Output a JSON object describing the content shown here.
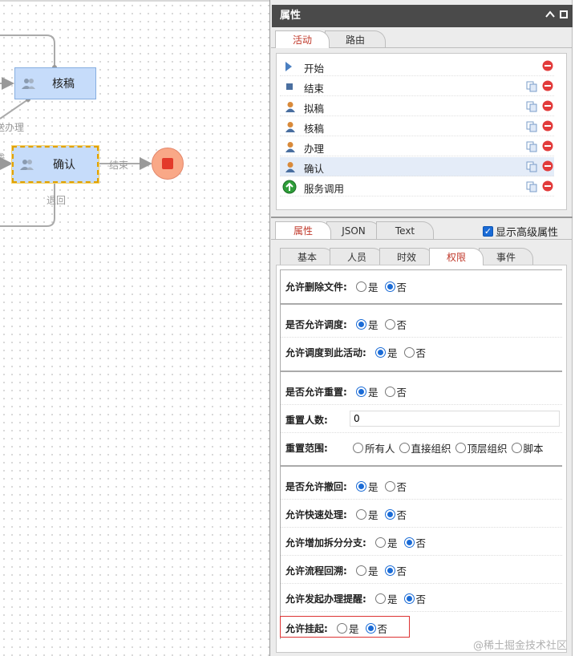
{
  "canvas": {
    "nodes": {
      "review": "核稿",
      "confirm": "确认"
    },
    "edge_labels": {
      "send": "送办理",
      "end": "结束",
      "back": "退回",
      "partial_left": "成"
    }
  },
  "panel": {
    "title": "属性",
    "top_tabs": [
      "活动",
      "路由"
    ],
    "activities": [
      {
        "label": "开始",
        "icon": "start-triangle-icon"
      },
      {
        "label": "结束",
        "icon": "end-square-icon"
      },
      {
        "label": "拟稿",
        "icon": "user-icon"
      },
      {
        "label": "核稿",
        "icon": "user-icon"
      },
      {
        "label": "办理",
        "icon": "user-icon"
      },
      {
        "label": "确认",
        "icon": "user-icon"
      },
      {
        "label": "服务调用",
        "icon": "service-icon"
      }
    ],
    "prop_tabs": [
      "属性",
      "JSON",
      "Text"
    ],
    "show_advanced": "显示高级属性",
    "sub_tabs": [
      "基本",
      "人员",
      "时效",
      "权限",
      "事件"
    ],
    "options": {
      "yes": "是",
      "no": "否"
    },
    "permissions": {
      "allow_delete_file": {
        "label": "允许删除文件:",
        "value": "否"
      },
      "allow_dispatch": {
        "label": "是否允许调度:",
        "value": "是"
      },
      "allow_dispatch_here": {
        "label": "允许调度到此活动:",
        "value": "是"
      },
      "allow_reset": {
        "label": "是否允许重置:",
        "value": "是"
      },
      "reset_count": {
        "label": "重置人数:",
        "value": "0"
      },
      "reset_scope": {
        "label": "重置范围:",
        "options": [
          "所有人",
          "直接组织",
          "顶层组织",
          "脚本"
        ]
      },
      "allow_withdraw": {
        "label": "是否允许撤回:",
        "value": "是"
      },
      "allow_quick": {
        "label": "允许快速处理:",
        "value": "否"
      },
      "allow_split": {
        "label": "允许增加拆分分支:",
        "value": "否"
      },
      "allow_backtrack": {
        "label": "允许流程回溯:",
        "value": "否"
      },
      "allow_remind": {
        "label": "允许发起办理提醒:",
        "value": "否"
      },
      "allow_suspend": {
        "label": "允许挂起:",
        "value": "否"
      }
    }
  },
  "watermark": "@稀土掘金技术社区",
  "colors": {
    "accent": "#1a6bd6",
    "tab_active_text": "#c0392b",
    "highlight": "#dd3333"
  }
}
